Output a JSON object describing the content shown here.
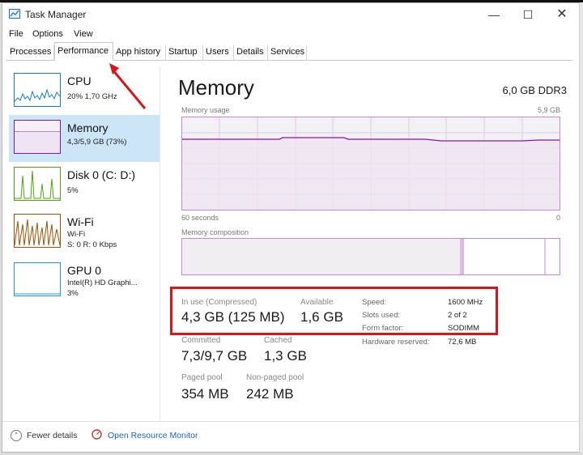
{
  "window": {
    "title": "Task Manager",
    "controls": {
      "minimize": "—",
      "maximize": "☐",
      "close": "✕"
    }
  },
  "menu": [
    "File",
    "Options",
    "View"
  ],
  "tabs": [
    "Processes",
    "Performance",
    "App history",
    "Startup",
    "Users",
    "Details",
    "Services"
  ],
  "active_tab": "Performance",
  "sidebar": [
    {
      "title": "CPU",
      "sub1": "20%  1,70 GHz",
      "sub2": "",
      "color": "#117dbb"
    },
    {
      "title": "Memory",
      "sub1": "4,3/5,9 GB (73%)",
      "sub2": "",
      "color": "#8b12ae"
    },
    {
      "title": "Disk 0 (C: D:)",
      "sub1": "5%",
      "sub2": "",
      "color": "#4da60c"
    },
    {
      "title": "Wi-Fi",
      "sub1": "Wi-Fi",
      "sub2": "S: 0  R: 0 Kbps",
      "color": "#a74f01"
    },
    {
      "title": "GPU 0",
      "sub1": "Intel(R) HD Graphi...",
      "sub2": "3%",
      "color": "#1c9dde"
    }
  ],
  "main": {
    "title": "Memory",
    "spec": "6,0 GB DDR3",
    "usage_label": "Memory usage",
    "usage_max": "5,9 GB",
    "time_left": "60 seconds",
    "time_right": "0",
    "composition_label": "Memory composition",
    "usage_level": 0.73,
    "composition": {
      "in_use": 0.74,
      "modified": 0.01,
      "standby": 0.22,
      "free": 0.03
    }
  },
  "stats": {
    "in_use_label": "In use (Compressed)",
    "in_use_value": "4,3 GB (125 MB)",
    "available_label": "Available",
    "available_value": "1,6 GB",
    "committed_label": "Committed",
    "committed_value": "7,3/9,7 GB",
    "cached_label": "Cached",
    "cached_value": "1,3 GB",
    "paged_label": "Paged pool",
    "paged_value": "354 MB",
    "nonpaged_label": "Non-paged pool",
    "nonpaged_value": "242 MB"
  },
  "specs": [
    {
      "label": "Speed:",
      "value": "1600 MHz"
    },
    {
      "label": "Slots used:",
      "value": "2 of 2"
    },
    {
      "label": "Form factor:",
      "value": "SODIMM"
    },
    {
      "label": "Hardware reserved:",
      "value": "72,6 MB"
    }
  ],
  "footer": {
    "fewer_details": "Fewer details",
    "resource_monitor": "Open Resource Monitor"
  },
  "colors": {
    "highlight": "#d9141a",
    "memory_accent": "#8b12ae",
    "link": "#1766c1",
    "selected": "#cde6f7"
  }
}
